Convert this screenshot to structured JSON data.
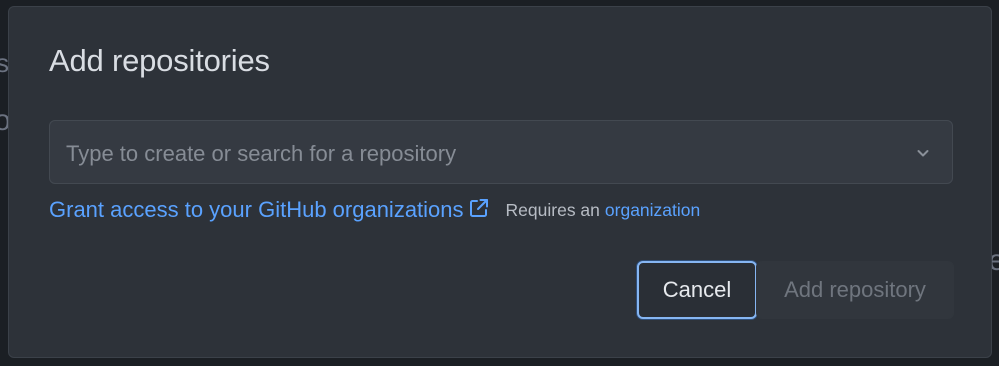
{
  "background": {
    "edge_left_top": "s",
    "edge_left_mid": "o",
    "edge_right": "e"
  },
  "dialog": {
    "title": "Add repositories",
    "search": {
      "placeholder": "Type to create or search for a repository",
      "value": "",
      "icon": "chevron-down-icon"
    },
    "grant_access": {
      "link_text": "Grant access to your GitHub organizations",
      "icon": "external-link-icon",
      "requires_text": "Requires an",
      "organization_link": "organization"
    },
    "buttons": {
      "cancel_label": "Cancel",
      "add_label": "Add repository",
      "add_enabled": false
    }
  },
  "colors": {
    "dialog_bg": "#2d3239",
    "link": "#5aa2ff",
    "focus_ring": "#86b6f3",
    "disabled_text": "#6f757e"
  }
}
